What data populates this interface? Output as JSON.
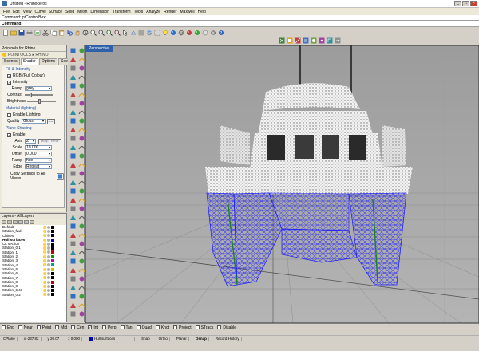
{
  "window": {
    "title": "Untitled - Rhinoceros",
    "buttons": [
      "_",
      "□",
      "×"
    ]
  },
  "menu": [
    "File",
    "Edit",
    "View",
    "Curve",
    "Surface",
    "Solid",
    "Mesh",
    "Dimension",
    "Transform",
    "Tools",
    "Analyze",
    "Render",
    "Maxwell",
    "Help"
  ],
  "command": {
    "history": "Command: ptControlBox",
    "label": "Command:",
    "value": ""
  },
  "panel": {
    "title": "Pointools for Rhino",
    "logo": "POINTOOLS ▸ RHINO",
    "tabs": [
      "Scenes",
      "Shader",
      "Options",
      "Sections"
    ],
    "active_tab": "Shader",
    "fill": {
      "head": "Fill & Intensity",
      "rgb": "RGB (Full Colour)",
      "intensity": "Intensity",
      "ramp_label": "Ramp",
      "ramp_value": "grey",
      "contrast_label": "Contrast",
      "brightness_label": "Brightness"
    },
    "material": {
      "head": "Material (lighting)",
      "enable": "Enable Lighting",
      "quality_label": "Quality",
      "quality_value": "Gloss",
      "more_button": "..."
    },
    "plane": {
      "head": "Plane Shading",
      "enable": "Enable",
      "axis_label": "Axis",
      "axis_value": "Z",
      "align_button": "Align view",
      "scale_label": "Scale",
      "scale_value": "10.000",
      "offset_label": "Offset",
      "offset_value": "0.000",
      "ramp_label": "Ramp",
      "ramp_value": "hue",
      "edge_label": "Edge",
      "edge_value": "Repeat"
    },
    "copy_button": "Copy Settings to All Views"
  },
  "layers": {
    "title": "Layers - All Layers",
    "rows": [
      {
        "name": "Default",
        "color": "#000000"
      },
      {
        "name": "Station_fwd",
        "color": "#000000"
      },
      {
        "name": "Chines",
        "color": "#000000"
      },
      {
        "name": "Hull surfaces",
        "color": "#0000c0",
        "current": true
      },
      {
        "name": "CL section",
        "color": "#000000"
      },
      {
        "name": "Station_0.1",
        "color": "#000000"
      },
      {
        "name": "Station_1",
        "color": "#c00000"
      },
      {
        "name": "Station_2",
        "color": "#00a000"
      },
      {
        "name": "Station_3",
        "color": "#c000c0"
      },
      {
        "name": "Station_4",
        "color": "#00a0a0"
      },
      {
        "name": "Station_5",
        "color": "#c0c000"
      },
      {
        "name": "Station_6",
        "color": "#000000"
      },
      {
        "name": "Station_7",
        "color": "#000000"
      },
      {
        "name": "Station_8",
        "color": "#c00000"
      },
      {
        "name": "Station_9",
        "color": "#000000"
      },
      {
        "name": "Station_0.4II",
        "color": "#000000"
      },
      {
        "name": "Station_0.2",
        "color": "#000000"
      }
    ]
  },
  "viewport": {
    "name": "Perspective"
  },
  "osnap": [
    "End",
    "Near",
    "Point",
    "Mid",
    "Cen",
    "Int",
    "Perp",
    "Tan",
    "Quad",
    "Knot",
    "Project",
    "STrack",
    "Disable"
  ],
  "status": {
    "plane": "CPlane",
    "x": "x -237.82",
    "y": "y 20.07",
    "z": "z 0.000",
    "layer": "Hull surfaces",
    "snap": "Snap",
    "ortho": "Ortho",
    "planar": "Planar",
    "osnap": "Osnap",
    "record": "Record History"
  },
  "colors": {
    "wire": "#1a1aff",
    "accent": "#3060a8"
  }
}
